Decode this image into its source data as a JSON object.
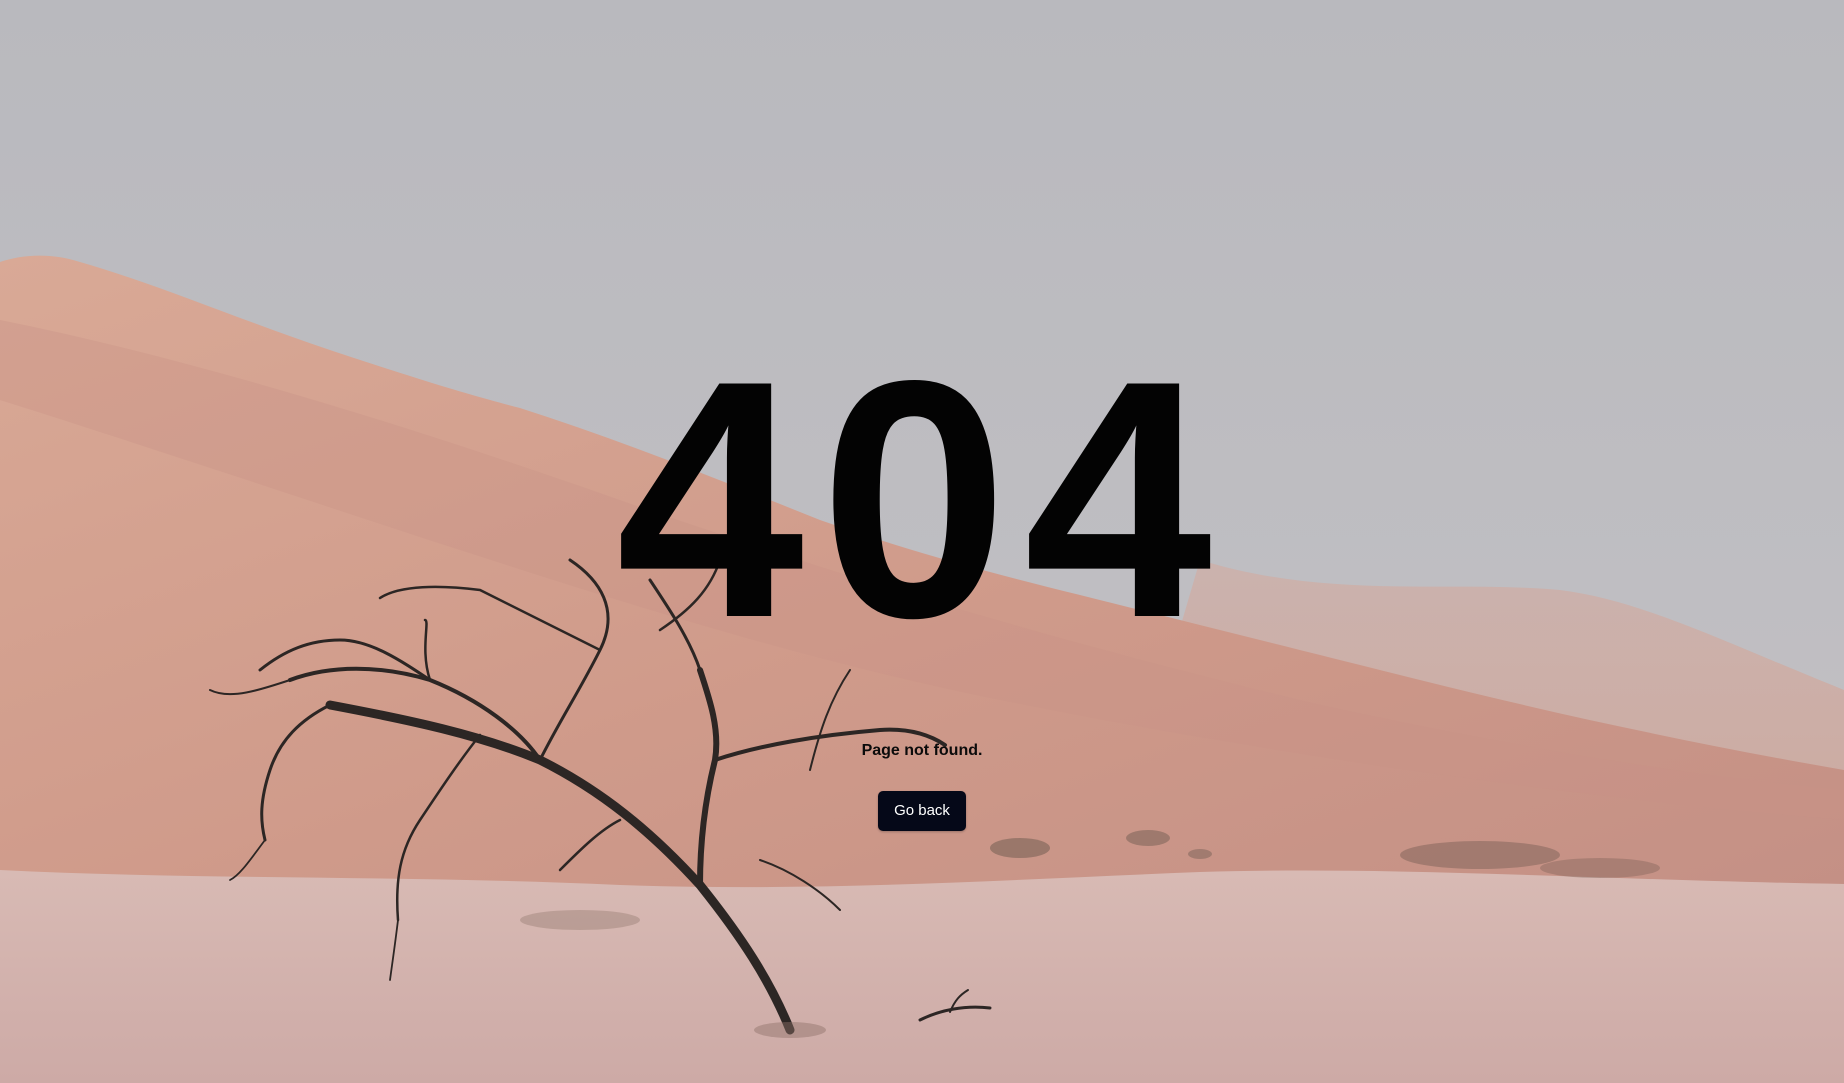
{
  "error": {
    "code": "404",
    "message": "Page not found."
  },
  "actions": {
    "back_label": "Go back"
  },
  "theme": {
    "sky": "#bbbbbf",
    "dune_peach": "#d49e8c",
    "dune_shadow": "#c28f82",
    "sand_floor": "#d7b7b1",
    "code_text": "#030303",
    "button_bg": "#050818",
    "button_text": "#ffffff"
  }
}
